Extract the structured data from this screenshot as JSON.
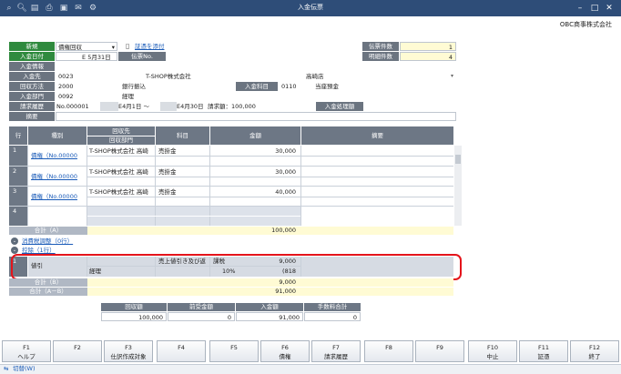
{
  "window": {
    "title": "入金伝票",
    "company": "OBC商事株式会社"
  },
  "header": {
    "new_label": "新規",
    "type_select": "債権回収",
    "attach_link": "証憑を添付",
    "deposit_date_label": "入金日付",
    "deposit_date_value": "5月31日",
    "deposit_date_prefix": "E",
    "voucher_no_label": "伝票No.",
    "voucher_count_label": "伝票件数",
    "voucher_count_value": "1",
    "detail_count_label": "明細件数",
    "detail_count_value": "4",
    "deposit_info_label": "入金情報",
    "payer_label": "入金先",
    "payer_code": "0023",
    "payer_name": "T-SHOP株式会社",
    "payer_branch": "高崎店",
    "method_label": "回収方法",
    "method_code": "2000",
    "method_name": "銀行振込",
    "account_label": "入金科目",
    "account_code": "0110",
    "account_name": "当座預金",
    "dept_label": "入金部門",
    "dept_code": "0092",
    "dept_name": "経理",
    "billing_label": "請求履歴",
    "billing_value": "No.000001",
    "billing_range": "E4月1日 ～",
    "billing_range2": "E4月30日",
    "billing_amount": "請求額：100,000",
    "processing_label": "入金処理額",
    "summary_label": "摘要"
  },
  "table": {
    "col_row": "行",
    "col_kind": "種別",
    "col_payer": "回収先",
    "col_dept": "回収部門",
    "col_subject": "科目",
    "col_amount": "金額",
    "col_memo": "摘要",
    "rows": [
      {
        "no": "1",
        "kind": "債権（No.00000",
        "payer": "T-SHOP株式会社 高崎",
        "subject": "売掛金",
        "amount": "30,000"
      },
      {
        "no": "2",
        "kind": "債権（No.00000",
        "payer": "T-SHOP株式会社 高崎",
        "subject": "売掛金",
        "amount": "30,000"
      },
      {
        "no": "3",
        "kind": "債権（No.00000",
        "payer": "T-SHOP株式会社 高崎",
        "subject": "売掛金",
        "amount": "40,000"
      },
      {
        "no": "4",
        "kind": "",
        "payer": "",
        "subject": "",
        "amount": ""
      }
    ],
    "total_a_label": "合計（A）",
    "total_a_value": "100,000",
    "tax_adjust_link": "消費税調整（0行）",
    "deduction_link": "控除（1行）",
    "deduction_row": {
      "no": "1",
      "kind": "値引",
      "dept": "経理",
      "subject": "売上値引き及び返",
      "tax_label": "課税",
      "tax_rate": "10%",
      "amount": "9,000",
      "tax_amount": "(818"
    },
    "total_b_label": "合計（B）",
    "total_b_value": "9,000",
    "total_ab_label": "合計（A－B）",
    "total_ab_value": "91,000"
  },
  "summary": {
    "headers": [
      "回収額",
      "前受金額",
      "入金額",
      "手数料合計"
    ],
    "values": [
      "100,000",
      "0",
      "91,000",
      "0"
    ]
  },
  "fkeys": [
    {
      "key": "F1",
      "label": "ヘルプ"
    },
    {
      "key": "F2",
      "label": ""
    },
    {
      "key": "F3",
      "label": "仕訳作成対象"
    },
    {
      "key": "F4",
      "label": ""
    },
    {
      "key": "F5",
      "label": ""
    },
    {
      "key": "F6",
      "label": "債権"
    },
    {
      "key": "F7",
      "label": "請求履歴"
    },
    {
      "key": "F8",
      "label": ""
    },
    {
      "key": "F9",
      "label": ""
    },
    {
      "key": "F10",
      "label": "中止"
    },
    {
      "key": "F11",
      "label": "証憑"
    },
    {
      "key": "F12",
      "label": "終了"
    }
  ],
  "status": {
    "switch_label": "切替(W)"
  }
}
